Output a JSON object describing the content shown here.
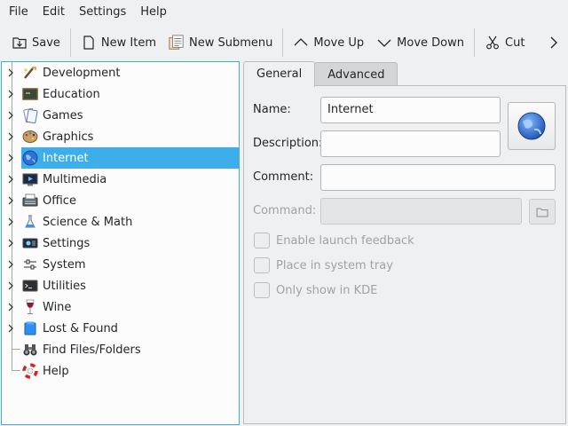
{
  "menubar": {
    "items": [
      "File",
      "Edit",
      "Settings",
      "Help"
    ]
  },
  "toolbar": {
    "save_label": "Save",
    "new_item_label": "New Item",
    "new_submenu_label": "New Submenu",
    "move_up_label": "Move Up",
    "move_down_label": "Move Down",
    "cut_label": "Cut"
  },
  "tree": {
    "items": [
      {
        "label": "Development",
        "icon": "development-icon",
        "expandable": true
      },
      {
        "label": "Education",
        "icon": "education-icon",
        "expandable": true
      },
      {
        "label": "Games",
        "icon": "games-icon",
        "expandable": true
      },
      {
        "label": "Graphics",
        "icon": "graphics-icon",
        "expandable": true
      },
      {
        "label": "Internet",
        "icon": "internet-icon",
        "expandable": true
      },
      {
        "label": "Multimedia",
        "icon": "multimedia-icon",
        "expandable": true
      },
      {
        "label": "Office",
        "icon": "office-icon",
        "expandable": true
      },
      {
        "label": "Science & Math",
        "icon": "science-icon",
        "expandable": true
      },
      {
        "label": "Settings",
        "icon": "settings-icon",
        "expandable": true
      },
      {
        "label": "System",
        "icon": "system-icon",
        "expandable": true
      },
      {
        "label": "Utilities",
        "icon": "utilities-icon",
        "expandable": true
      },
      {
        "label": "Wine",
        "icon": "wine-icon",
        "expandable": true
      },
      {
        "label": "Lost & Found",
        "icon": "lost-found-icon",
        "expandable": true
      },
      {
        "label": "Find Files/Folders",
        "icon": "binoculars-icon",
        "expandable": false
      },
      {
        "label": "Help",
        "icon": "lifebuoy-icon",
        "expandable": false
      }
    ],
    "selected": "Internet"
  },
  "tabs": [
    "General",
    "Advanced"
  ],
  "form": {
    "name_label": "Name:",
    "name_value": "Internet",
    "description_label": "Description:",
    "description_value": "",
    "comment_label": "Comment:",
    "comment_value": "",
    "command_label": "Command:",
    "command_value": "",
    "launch_feedback_label": "Enable launch feedback",
    "system_tray_label": "Place in system tray",
    "kde_only_label": "Only show in KDE"
  },
  "colors": {
    "accent": "#3daee9",
    "window_bg": "#eff0f1"
  }
}
